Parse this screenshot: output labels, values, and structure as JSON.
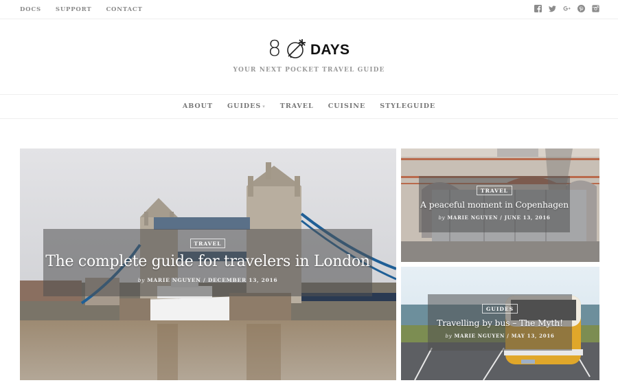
{
  "topbar": {
    "links": [
      "DOCS",
      "SUPPORT",
      "CONTACT"
    ],
    "social": [
      "facebook-icon",
      "twitter-icon",
      "google-plus-icon",
      "pinterest-icon",
      "instagram-icon"
    ]
  },
  "brand": {
    "logo_number": "8",
    "logo_word": "DAYS",
    "logo_icon": "globe-airplane-icon",
    "tagline": "YOUR NEXT POCKET TRAVEL GUIDE"
  },
  "nav": {
    "items": [
      {
        "label": "ABOUT",
        "has_dropdown": false
      },
      {
        "label": "GUIDES",
        "has_dropdown": true
      },
      {
        "label": "TRAVEL",
        "has_dropdown": false
      },
      {
        "label": "CUISINE",
        "has_dropdown": false
      },
      {
        "label": "STYLEGUIDE",
        "has_dropdown": false
      }
    ]
  },
  "featured": {
    "main": {
      "category": "TRAVEL",
      "title": "The complete guide for travelers in London",
      "by": "by",
      "author": "MARIE NGUYEN",
      "separator": "/",
      "date": "DECEMBER 13, 2016",
      "image": "Tower Bridge over the Thames with a white cruise ship"
    },
    "side": [
      {
        "category": "TRAVEL",
        "title": "A peaceful moment in Copenhagen",
        "by": "by",
        "author": "MARIE NGUYEN",
        "separator": "/",
        "date": "JUNE 13, 2016",
        "image": "Brick building facade with grey garage doors"
      },
      {
        "category": "GUIDES",
        "title": "Travelling by bus – The Myth!",
        "by": "by",
        "author": "MARIE NGUYEN",
        "separator": "/",
        "date": "MAY 13, 2016",
        "image": "Yellow VW bus parked by the sea"
      }
    ]
  }
}
